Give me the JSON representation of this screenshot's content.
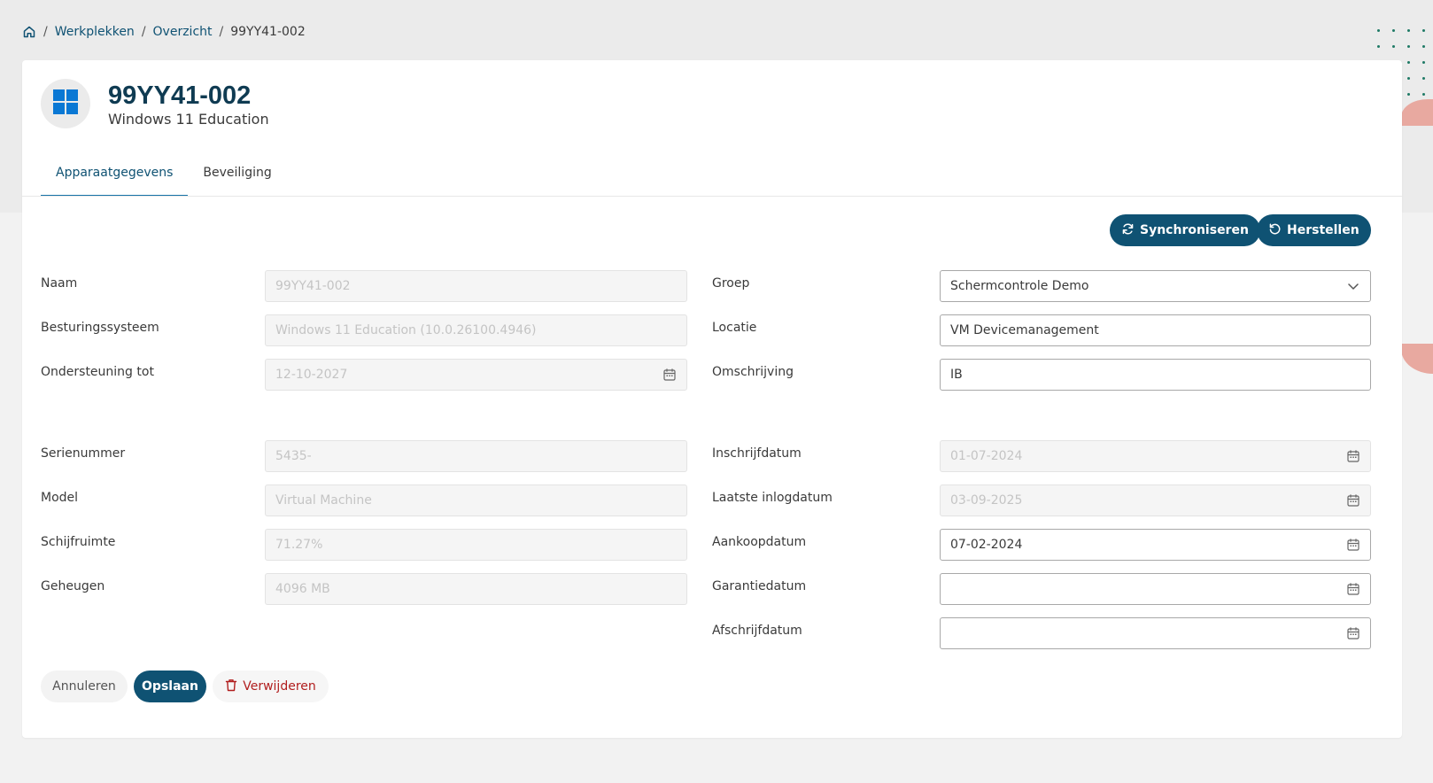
{
  "breadcrumb": {
    "home_icon": "home-icon",
    "items": [
      "Werkplekken",
      "Overzicht"
    ],
    "current": "99YY41-002",
    "separator": "/"
  },
  "device": {
    "icon": "windows-logo-icon",
    "title": "99YY41-002",
    "subtitle": "Windows 11 Education"
  },
  "tabs": [
    {
      "label": "Apparaatgegevens",
      "active": true
    },
    {
      "label": "Beveiliging",
      "active": false
    }
  ],
  "toolbar": {
    "sync_label": "Synchroniseren",
    "restore_label": "Herstellen"
  },
  "left_fields": [
    {
      "label": "Naam",
      "value": "99YY41-002",
      "disabled": true
    },
    {
      "label": "Besturingssysteem",
      "value": "Windows 11 Education (10.0.26100.4946)",
      "disabled": true
    },
    {
      "label": "Ondersteuning tot",
      "value": "12-10-2027",
      "disabled": true,
      "calendar": true
    },
    {
      "label": "Serienummer",
      "value": "5435-",
      "disabled": true
    },
    {
      "label": "Model",
      "value": "Virtual Machine",
      "disabled": true
    },
    {
      "label": "Schijfruimte",
      "value": "71.27%",
      "disabled": true
    },
    {
      "label": "Geheugen",
      "value": "4096 MB",
      "disabled": true
    }
  ],
  "right_fields": [
    {
      "label": "Groep",
      "value": "Schermcontrole Demo",
      "type": "select"
    },
    {
      "label": "Locatie",
      "value": "VM Devicemanagement"
    },
    {
      "label": "Omschrijving",
      "value": "IB"
    },
    {
      "label": "Inschrijfdatum",
      "value": "01-07-2024",
      "disabled": true,
      "calendar": true
    },
    {
      "label": "Laatste inlogdatum",
      "value": "03-09-2025",
      "disabled": true,
      "calendar": true
    },
    {
      "label": "Aankoopdatum",
      "value": "07-02-2024",
      "calendar": true
    },
    {
      "label": "Garantiedatum",
      "value": "",
      "calendar": true
    },
    {
      "label": "Afschrijfdatum",
      "value": "",
      "calendar": true
    }
  ],
  "actions": {
    "cancel_label": "Annuleren",
    "save_label": "Opslaan",
    "delete_label": "Verwijderen"
  },
  "colors": {
    "primary": "#0f5273",
    "title": "#0f3b52",
    "danger": "#b11e1e",
    "windows_blue": "#0a78d4",
    "accent_dots": "#1f7a66",
    "accent_pink": "#e8a9a0"
  }
}
